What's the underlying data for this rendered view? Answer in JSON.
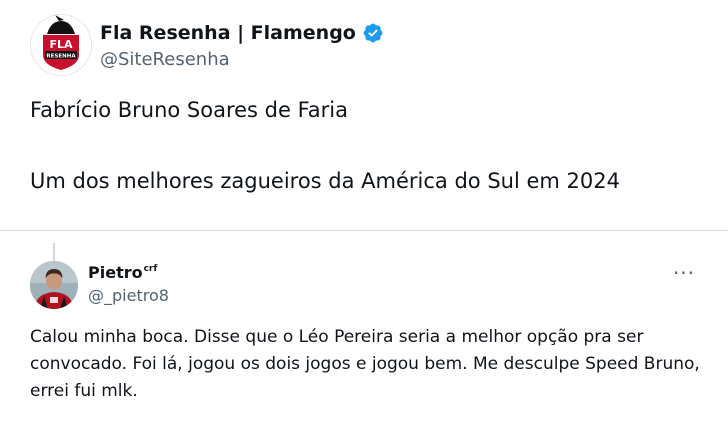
{
  "main_tweet": {
    "author_name": "Fla Resenha | Flamengo",
    "handle": "@SiteResenha",
    "avatar_text": "FLA",
    "avatar_subtext": "RESENHA",
    "text_line_1": "Fabrício Bruno Soares de Faria",
    "text_line_2": "Um dos melhores zagueiros da América do Sul em 2024"
  },
  "quoted_tweet": {
    "author_name": "Pietro",
    "author_suffix": "crf",
    "handle": "@_pietro8",
    "more_label": "···",
    "text": "Calou minha boca. Disse que o Léo Pereira seria a melhor opção pra ser convocado. Foi lá, jogou os dois jogos e jogou bem. Me desculpe Speed Bruno, errei fui mlk."
  },
  "colors": {
    "verified_blue": "#1d9bf0",
    "avatar_red": "#c8102e",
    "avatar_black": "#111111",
    "secondary_text": "#536471"
  },
  "icons": {
    "verified": "verified-badge-icon",
    "more": "more-icon"
  }
}
